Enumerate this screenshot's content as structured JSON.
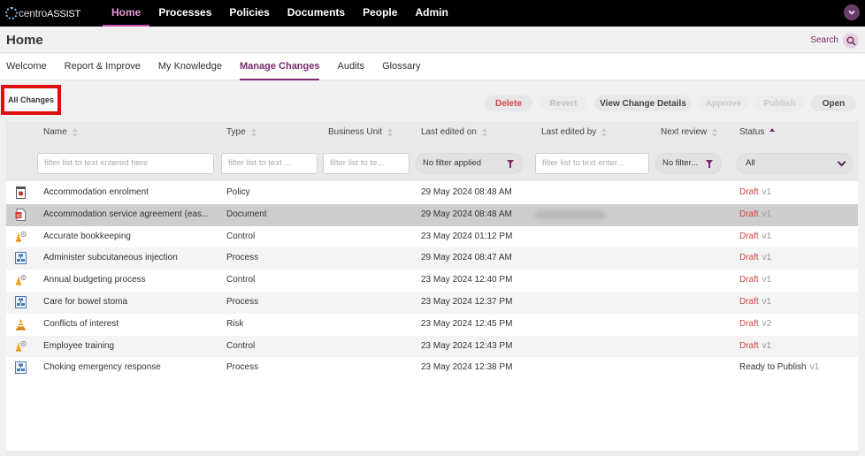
{
  "nav": {
    "logo_text": "centro",
    "logo_bold": "ASSIST",
    "items": [
      "Home",
      "Processes",
      "Policies",
      "Documents",
      "People",
      "Admin"
    ],
    "active": "Home"
  },
  "header": {
    "title": "Home",
    "search_label": "Search"
  },
  "tabs": [
    "Welcome",
    "Report & Improve",
    "My Knowledge",
    "Manage Changes",
    "Audits",
    "Glossary"
  ],
  "active_tab": "Manage Changes",
  "toolbar": {
    "all_changes": "All Changes",
    "delete": "Delete",
    "revert": "Revert",
    "view_details": "View Change Details",
    "approve": "Approve",
    "publish": "Publish",
    "open": "Open"
  },
  "columns": {
    "name": "Name",
    "type": "Type",
    "business_unit": "Business Unit",
    "last_edited_on": "Last edited on",
    "last_edited_by": "Last edited by",
    "next_review": "Next review",
    "status": "Status"
  },
  "filters": {
    "name_placeholder": "filter list to text entered here",
    "type_placeholder": "filter list to text ...",
    "bu_placeholder": "filter list to te...",
    "edited_on_value": "No filter applied",
    "edited_by_placeholder": "filter list to text enter...",
    "next_review_value": "No filter...",
    "status_value": "All"
  },
  "rows": [
    {
      "icon": "policy-icon",
      "name": "Accommodation enrolment",
      "type": "Policy",
      "edited_on": "29 May 2024 08:48 AM",
      "status": "Draft",
      "version": "v1"
    },
    {
      "icon": "document-icon",
      "name": "Accommodation service agreement (eas...",
      "type": "Document",
      "edited_on": "29 May 2024 08:48 AM",
      "status": "Draft",
      "version": "v1"
    },
    {
      "icon": "control-icon",
      "name": "Accurate bookkeeping",
      "type": "Control",
      "edited_on": "23 May 2024 01:12 PM",
      "status": "Draft",
      "version": "v1"
    },
    {
      "icon": "process-icon",
      "name": "Administer subcutaneous injection",
      "type": "Process",
      "edited_on": "29 May 2024 08:47 AM",
      "status": "Draft",
      "version": "v1"
    },
    {
      "icon": "control-icon",
      "name": "Annual budgeting process",
      "type": "Control",
      "edited_on": "23 May 2024 12:40 PM",
      "status": "Draft",
      "version": "v1"
    },
    {
      "icon": "process-icon",
      "name": "Care for bowel stoma",
      "type": "Process",
      "edited_on": "23 May 2024 12:37 PM",
      "status": "Draft",
      "version": "v1"
    },
    {
      "icon": "risk-icon",
      "name": "Conflicts of interest",
      "type": "Risk",
      "edited_on": "23 May 2024 12:45 PM",
      "status": "Draft",
      "version": "v2"
    },
    {
      "icon": "control-icon",
      "name": "Employee training",
      "type": "Control",
      "edited_on": "23 May 2024 12:43 PM",
      "status": "Draft",
      "version": "v1"
    },
    {
      "icon": "process-icon",
      "name": "Choking emergency response",
      "type": "Process",
      "edited_on": "23 May 2024 12:38 PM",
      "status": "Ready to Publish",
      "version": "v1"
    }
  ],
  "colors": {
    "brand": "#7a2a6e",
    "draft": "#d04545",
    "highlight": "#e10e0e"
  }
}
